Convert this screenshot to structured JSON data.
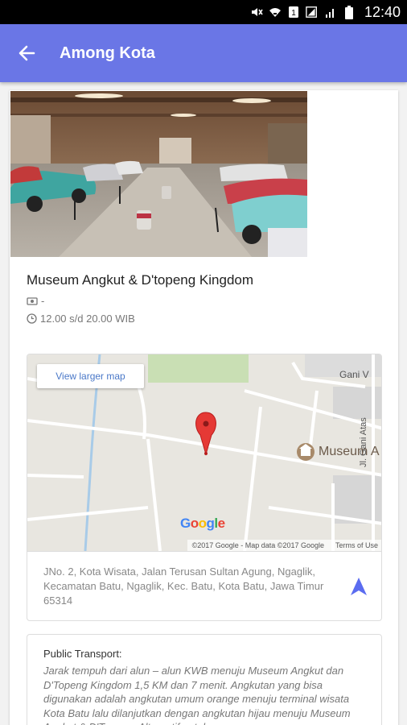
{
  "status_bar": {
    "time": "12:40",
    "icons": [
      "mute-icon",
      "wifi-icon",
      "notification-icon",
      "signal-icon",
      "battery-icon"
    ]
  },
  "app_bar": {
    "title": "Among Kota",
    "back_icon": "arrow-left-icon",
    "color": "#6a76e6"
  },
  "place": {
    "name": "Museum Angkut & D'topeng Kingdom",
    "price": "-",
    "price_icon": "money-icon",
    "hours": "12.00 s/d 20.00 WIB",
    "hours_icon": "clock-icon"
  },
  "map": {
    "larger_map_label": "View larger map",
    "marker_label": "Museum A",
    "street_label_top": "Gani V",
    "street_label_side": "Jl. Gani Atas",
    "logo": [
      "G",
      "o",
      "o",
      "g",
      "l",
      "e"
    ],
    "attribution": "©2017 Google - Map data ©2017 Google",
    "terms": "Terms of Use",
    "pin_color": "#e53935"
  },
  "address": {
    "text": "JNo. 2, Kota Wisata, Jalan Terusan Sultan Agung, Ngaglik, Kecamatan Batu, Ngaglik, Kec. Batu, Kota Batu, Jawa Timur 65314",
    "nav_icon": "navigation-arrow-icon",
    "nav_color": "#5b6cf0"
  },
  "transport": {
    "heading": "Public Transport:",
    "body": "Jarak tempuh dari alun – alun KWB menuju Museum Angkut dan D'Topeng Kingdom 1,5 KM dan 7 menit. Angkutan  yang bisa digunakan adalah angkutan umum orange menuju terminal wisata Kota Batu lalu dilanjutkan dengan angkutan hijau menuju Museum Angkut & D'Topeng. Alternatif untuk"
  }
}
